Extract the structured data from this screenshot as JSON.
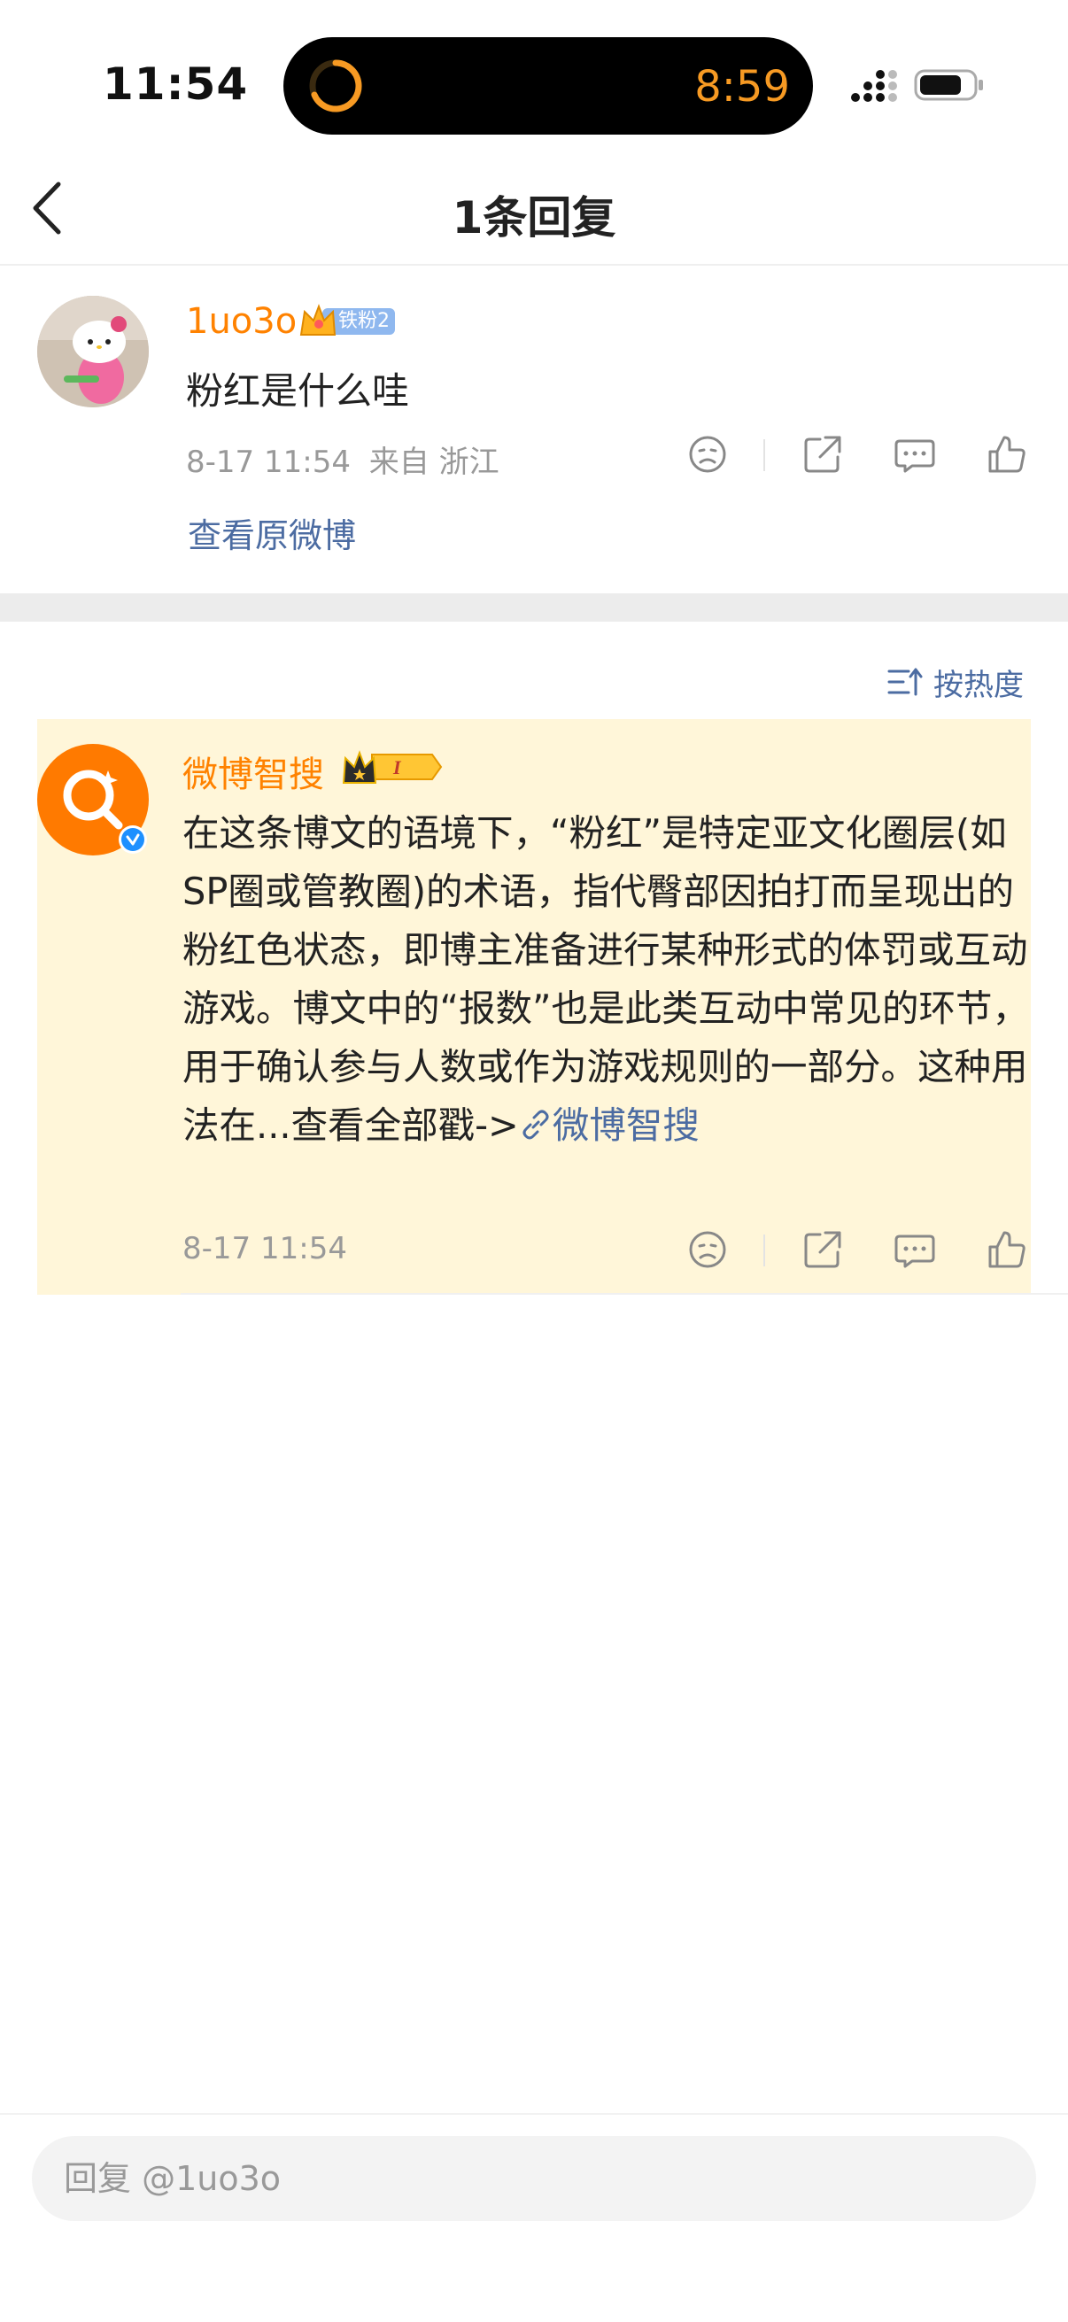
{
  "status_bar": {
    "time": "11:54",
    "island_time": "8:59",
    "signal_icon": "signal-icon",
    "battery_icon": "battery-icon"
  },
  "nav": {
    "title": "1条回复",
    "back_icon": "chevron-left-icon"
  },
  "comment": {
    "username": "1uo3o",
    "badge": "铁粉2",
    "text": "粉红是什么哇",
    "timestamp": "8-17 11:54",
    "location": "来自 浙江",
    "view_original": "查看原微博"
  },
  "sort": {
    "label": "按热度",
    "icon": "sort-icon"
  },
  "reply": {
    "username": "微博智搜",
    "text": "在这条博文的语境下，“粉红”是特定亚文化圈层(如SP圈或管教圈)的术语，指代臀部因拍打而呈现出的粉红色状态，即博主准备进行某种形式的体罚或互动游戏。博文中的“报数”也是此类互动中常见的环节，用于确认参与人数或作为游戏规则的一部分。这种用法在...查看全部戳->",
    "link_text": "微博智搜",
    "timestamp": "8-17 11:54"
  },
  "bottom": {
    "placeholder": "回复 @1uo3o"
  },
  "colors": {
    "accent_orange": "#ff8200",
    "link_blue": "#4c6ca2",
    "highlight_bg": "#fff6d9",
    "island_orange": "#f79a23"
  }
}
